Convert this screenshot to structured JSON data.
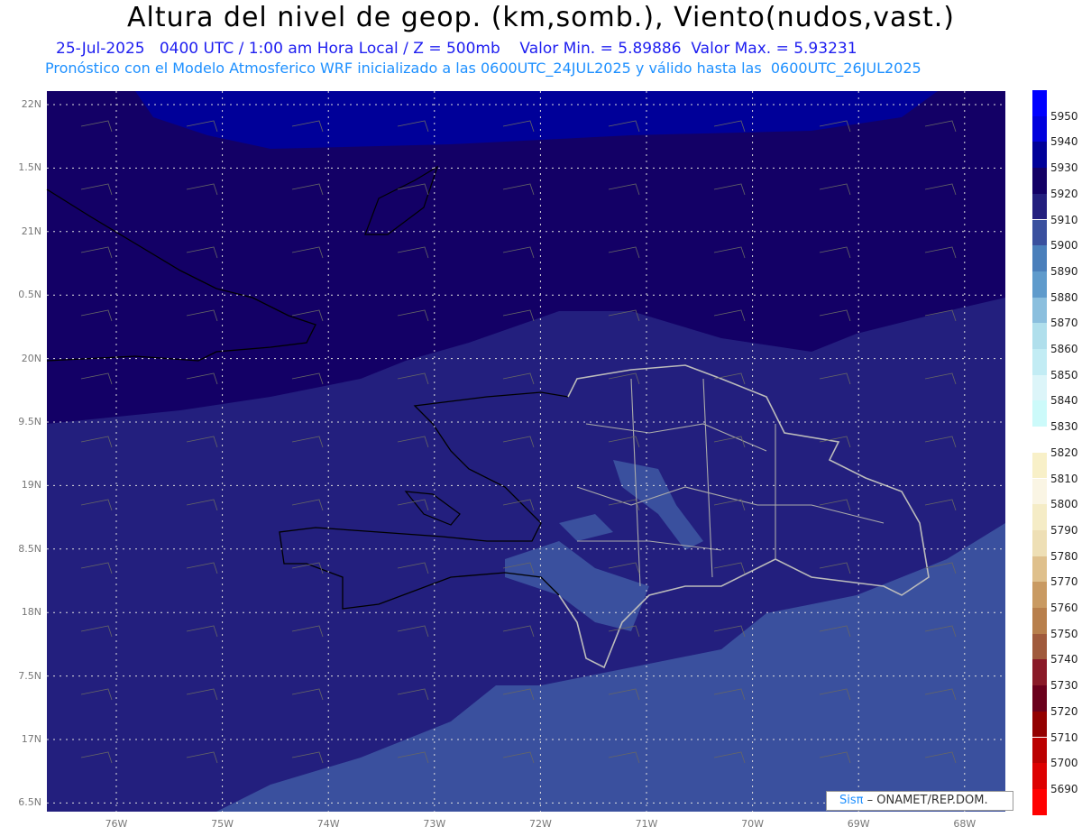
{
  "header": {
    "title": "Altura del nivel de geop. (km,somb.), Viento(nudos,vast.)",
    "line1": "25-Jul-2025   0400 UTC / 1:00 am Hora Local / Z = 500mb    Valor Min. = 5.89886  Valor Max. = 5.93231",
    "line2": "Pronóstico con el Modelo Atmosferico WRF inicializado a las 0600UTC_24JUL2025 y válido hasta las  0600UTC_26JUL2025"
  },
  "lat_labels": [
    "22N",
    "1.5N",
    "21N",
    "0.5N",
    "20N",
    "9.5N",
    "19N",
    "8.5N",
    "18N",
    "7.5N",
    "17N",
    "6.5N"
  ],
  "lon_labels": [
    "76W",
    "75W",
    "74W",
    "73W",
    "72W",
    "71W",
    "70W",
    "69W",
    "68W"
  ],
  "colorbar": {
    "labels": [
      "5950",
      "5940",
      "5930",
      "5920",
      "5910",
      "5900",
      "5890",
      "5880",
      "5870",
      "5860",
      "5850",
      "5840",
      "5830",
      "5820",
      "5810",
      "5800",
      "5790",
      "5780",
      "5770",
      "5760",
      "5750",
      "5740",
      "5730",
      "5720",
      "5710",
      "5700",
      "5690"
    ],
    "colors": [
      "#0000ff",
      "#0000dd",
      "#000099",
      "#130066",
      "#231f7e",
      "#3a509e",
      "#4a7fbb",
      "#5f9bcc",
      "#8bbfde",
      "#b0dfec",
      "#c2ecf4",
      "#dcf5f9",
      "#ccfafa",
      "#ffffff",
      "#f8f0c8",
      "#faf5e4",
      "#f5ecc6",
      "#eedfb5",
      "#dfc08c",
      "#c99a62",
      "#b87f4c",
      "#a05a3c",
      "#8a1a28",
      "#6b001c",
      "#930000",
      "#bb0000",
      "#dd0000",
      "#ff0000"
    ]
  },
  "credit": {
    "brand": "Sisπ",
    "org": "– ONAMET/REP.DOM."
  }
}
